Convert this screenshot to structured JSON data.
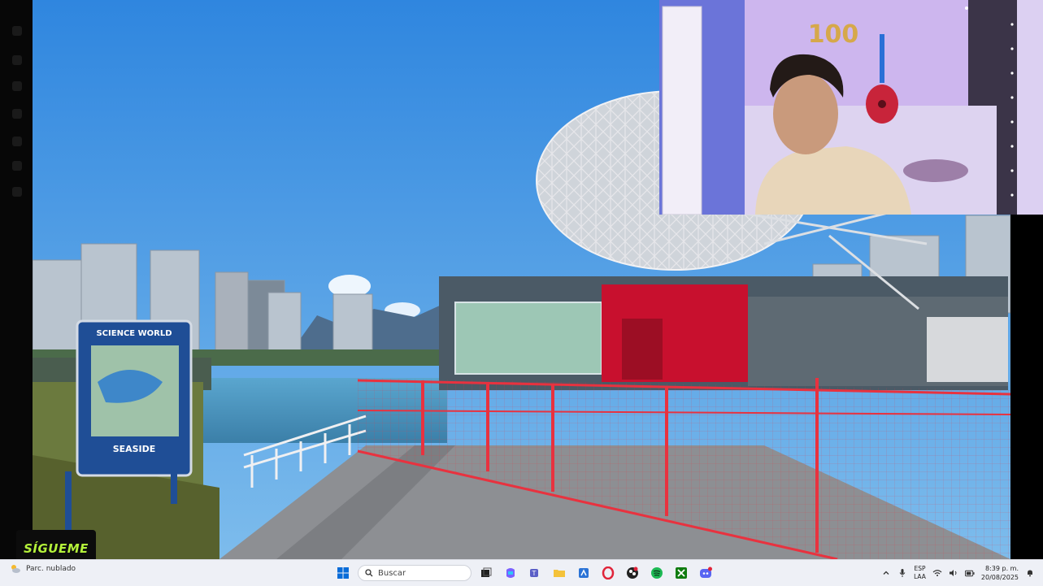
{
  "overlay": {
    "follow_label": "SÍGUEME"
  },
  "scene": {
    "sign_brand": "SCIENCE WORLD",
    "sign_caption": "SEASIDE",
    "balloon_text": "100"
  },
  "taskbar": {
    "weather_text": "Parc. nublado",
    "search_placeholder": "Buscar",
    "language_top": "ESP",
    "language_bottom": "LAA",
    "time": "8:39 p. m.",
    "date": "20/08/2025",
    "apps": [
      {
        "name": "windows-start-icon",
        "color": "#0a6cd8"
      },
      {
        "name": "task-view-icon",
        "color": "#222222"
      },
      {
        "name": "copilot-icon",
        "color": "#7b61ff"
      },
      {
        "name": "teams-icon",
        "color": "#5b5fc7"
      },
      {
        "name": "file-explorer-icon",
        "color": "#f4c23a"
      },
      {
        "name": "store-icon",
        "color": "#2b73d6"
      },
      {
        "name": "opera-icon",
        "color": "#e0243a"
      },
      {
        "name": "obs-icon",
        "color": "#222222"
      },
      {
        "name": "spotify-icon",
        "color": "#1db954"
      },
      {
        "name": "xbox-icon",
        "color": "#107c10"
      },
      {
        "name": "discord-icon",
        "color": "#5865f2"
      }
    ]
  },
  "colors": {
    "sky": "#3a8fe0",
    "fence": "#e8323f",
    "dome_red": "#c8102e",
    "overlay_green": "#b4f23a",
    "wall_purple": "#cdb6ee"
  }
}
